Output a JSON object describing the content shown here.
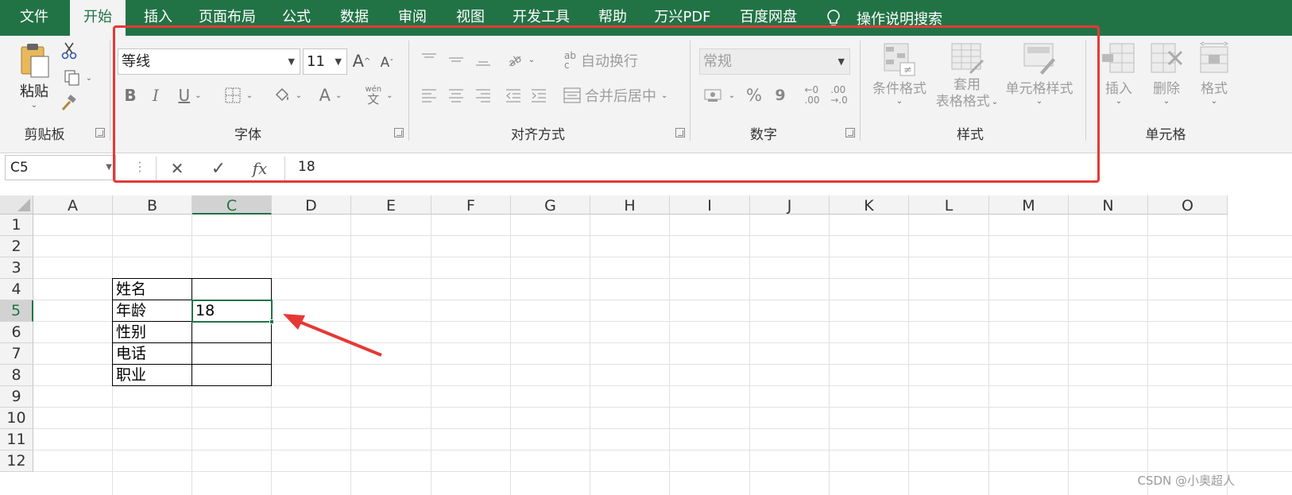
{
  "tabs": [
    {
      "label": "文件",
      "active": false
    },
    {
      "label": "开始",
      "active": true
    },
    {
      "label": "插入",
      "active": false
    },
    {
      "label": "页面布局",
      "active": false
    },
    {
      "label": "公式",
      "active": false
    },
    {
      "label": "数据",
      "active": false
    },
    {
      "label": "审阅",
      "active": false
    },
    {
      "label": "视图",
      "active": false
    },
    {
      "label": "开发工具",
      "active": false
    },
    {
      "label": "帮助",
      "active": false
    },
    {
      "label": "万兴PDF",
      "active": false
    },
    {
      "label": "百度网盘",
      "active": false
    }
  ],
  "tell_me": {
    "icon": "lightbulb-icon",
    "label": "操作说明搜索"
  },
  "clipboard": {
    "paste_label": "粘贴",
    "group_label": "剪贴板"
  },
  "font": {
    "family": "等线",
    "size": "11",
    "group_label": "字体",
    "bold": "B",
    "italic": "I",
    "underline": "U",
    "font_color": "A",
    "increase": "A",
    "decrease": "A",
    "phonetic_top": "wén",
    "phonetic_bottom": "文"
  },
  "alignment": {
    "wrap_label": "自动换行",
    "wrap_icon_top": "ab",
    "wrap_icon_bottom": "c",
    "merge_label": "合并后居中",
    "group_label": "对齐方式"
  },
  "number": {
    "format": "常规",
    "group_label": "数字",
    "percent": "%",
    "comma": "9",
    "increase_decimal_top": "←0",
    "increase_decimal_bottom": ".00",
    "decrease_decimal_top": ".00",
    "decrease_decimal_bottom": "→.0"
  },
  "styles": {
    "conditional": "条件格式",
    "format_table_1": "套用",
    "format_table_2": "表格格式",
    "cell_styles": "单元格样式",
    "group_label": "样式"
  },
  "cells": {
    "insert": "插入",
    "delete": "删除",
    "format": "格式",
    "group_label": "单元格"
  },
  "formula_bar": {
    "name_box": "C5",
    "cancel": "✕",
    "enter": "✓",
    "fx": "fx",
    "value": "18"
  },
  "columns": [
    "A",
    "B",
    "C",
    "D",
    "E",
    "F",
    "G",
    "H",
    "I",
    "J",
    "K",
    "L",
    "M",
    "N",
    "O"
  ],
  "rows": [
    "1",
    "2",
    "3",
    "4",
    "5",
    "6",
    "7",
    "8",
    "9",
    "10",
    "11",
    "12"
  ],
  "selected_cell": {
    "column": "C",
    "row": "5"
  },
  "sheet_cells": {
    "B4": "姓名",
    "B5": "年龄",
    "B6": "性别",
    "B7": "电话",
    "B8": "职业",
    "C5": "18"
  },
  "annotation_color": "#e53935",
  "accent_color": "#217346",
  "watermark": "CSDN @小奥超人"
}
